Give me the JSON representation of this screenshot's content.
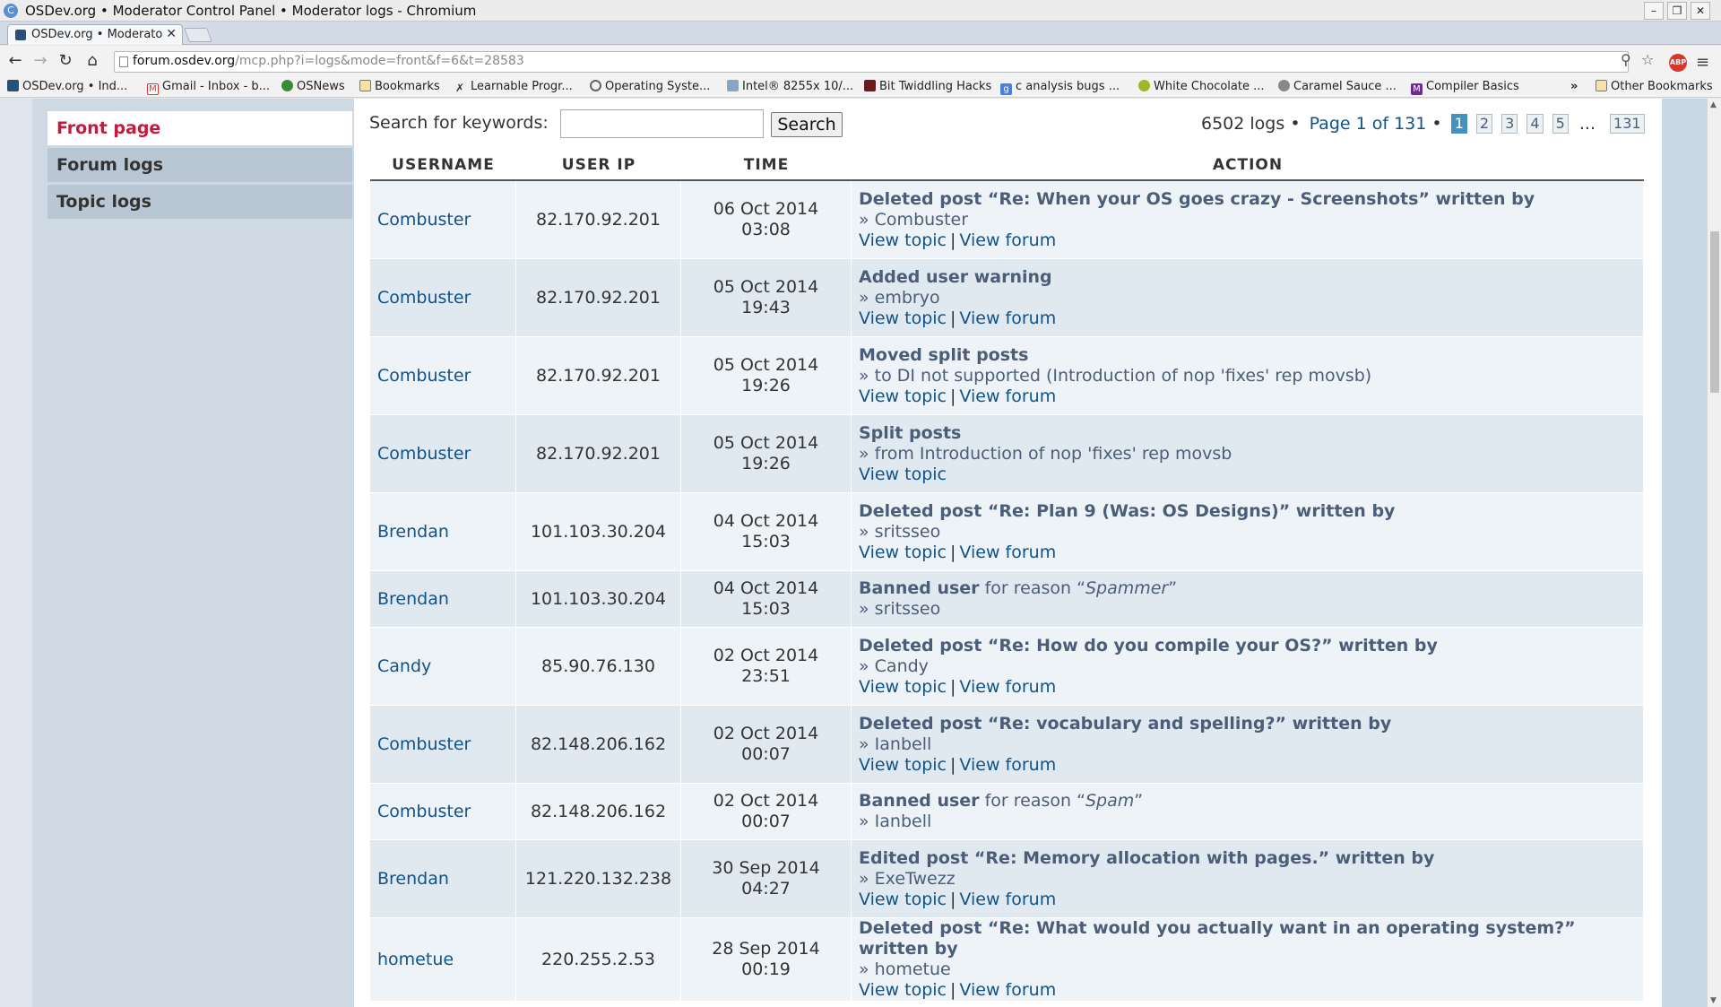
{
  "window": {
    "title": "OSDev.org • Moderator Control Panel • Moderator logs - Chromium"
  },
  "tabs": [
    {
      "title": "OSDev.org • Moderato"
    }
  ],
  "toolbar": {
    "url_host": "forum.osdev.org",
    "url_rest": "/mcp.php?i=logs&mode=front&f=6&t=28583"
  },
  "bookmarks": [
    "OSDev.org • Ind...",
    "Gmail - Inbox - b...",
    "OSNews",
    "Bookmarks",
    "Learnable Progr...",
    "Operating Syste...",
    "Intel® 8255x 10/...",
    "Bit Twiddling Hacks",
    "c analysis bugs ...",
    "White Chocolate ...",
    "Caramel Sauce ...",
    "Compiler Basics"
  ],
  "other_bookmarks": "Other Bookmarks",
  "overflow_chevron": "»",
  "sidebar": {
    "items": [
      "Front page",
      "Forum logs",
      "Topic logs"
    ]
  },
  "search": {
    "label": "Search for keywords:",
    "value": "",
    "button": "Search"
  },
  "pagination": {
    "count": "6502 logs",
    "sep": "•",
    "info": "Page 1 of 131",
    "pages": [
      "1",
      "2",
      "3",
      "4",
      "5"
    ],
    "ellipsis": "...",
    "last": "131"
  },
  "table": {
    "headers": [
      "USERNAME",
      "USER IP",
      "TIME",
      "ACTION"
    ],
    "rows": [
      {
        "user": "Combuster",
        "ip": "82.170.92.201",
        "date": "06 Oct 2014",
        "clock": "03:08",
        "action": "Deleted post “Re: When your OS goes crazy - Screenshots” written by",
        "reason": "",
        "reason_value": "",
        "reason_close": "",
        "detail": "» Combuster",
        "link1": "View topic",
        "link2": "View forum"
      },
      {
        "user": "Combuster",
        "ip": "82.170.92.201",
        "date": "05 Oct 2014",
        "clock": "19:43",
        "action": "Added user warning",
        "reason": "",
        "reason_value": "",
        "reason_close": "",
        "detail": "» embryo",
        "link1": "View topic",
        "link2": "View forum"
      },
      {
        "user": "Combuster",
        "ip": "82.170.92.201",
        "date": "05 Oct 2014",
        "clock": "19:26",
        "action": "Moved split posts",
        "reason": "",
        "reason_value": "",
        "reason_close": "",
        "detail": "» to DI not supported (Introduction of nop 'fixes' rep movsb)",
        "link1": "View topic",
        "link2": "View forum"
      },
      {
        "user": "Combuster",
        "ip": "82.170.92.201",
        "date": "05 Oct 2014",
        "clock": "19:26",
        "action": "Split posts",
        "reason": "",
        "reason_value": "",
        "reason_close": "",
        "detail": "» from Introduction of nop 'fixes' rep movsb",
        "link1": "View topic",
        "link2": ""
      },
      {
        "user": "Brendan",
        "ip": "101.103.30.204",
        "date": "04 Oct 2014",
        "clock": "15:03",
        "action": "Deleted post “Re: Plan 9 (Was: OS Designs)” written by",
        "reason": "",
        "reason_value": "",
        "reason_close": "",
        "detail": "» sritsseo",
        "link1": "View topic",
        "link2": "View forum"
      },
      {
        "user": "Brendan",
        "ip": "101.103.30.204",
        "date": "04 Oct 2014",
        "clock": "15:03",
        "action": "Banned user",
        "reason": " for reason “",
        "reason_value": "Spammer",
        "reason_close": "”",
        "detail": "» sritsseo",
        "link1": "",
        "link2": ""
      },
      {
        "user": "Candy",
        "ip": "85.90.76.130",
        "date": "02 Oct 2014",
        "clock": "23:51",
        "action": "Deleted post “Re: How do you compile your OS?” written by",
        "reason": "",
        "reason_value": "",
        "reason_close": "",
        "detail": "» Candy",
        "link1": "View topic",
        "link2": "View forum"
      },
      {
        "user": "Combuster",
        "ip": "82.148.206.162",
        "date": "02 Oct 2014",
        "clock": "00:07",
        "action": "Deleted post “Re: vocabulary and spelling?” written by",
        "reason": "",
        "reason_value": "",
        "reason_close": "",
        "detail": "» Ianbell",
        "link1": "View topic",
        "link2": "View forum"
      },
      {
        "user": "Combuster",
        "ip": "82.148.206.162",
        "date": "02 Oct 2014",
        "clock": "00:07",
        "action": "Banned user",
        "reason": " for reason “",
        "reason_value": "Spam",
        "reason_close": "”",
        "detail": "» Ianbell",
        "link1": "",
        "link2": ""
      },
      {
        "user": "Brendan",
        "ip": "121.220.132.238",
        "date": "30 Sep 2014",
        "clock": "04:27",
        "action": "Edited post “Re: Memory allocation with pages.” written by",
        "reason": "",
        "reason_value": "",
        "reason_close": "",
        "detail": "» ExeTwezz",
        "link1": "View topic",
        "link2": "View forum"
      },
      {
        "user": "hometue",
        "ip": "220.255.2.53",
        "date": "28 Sep 2014",
        "clock": "00:19",
        "action": "Deleted post “Re: What would you actually want in an operating system?” written by",
        "reason": "",
        "reason_value": "",
        "reason_close": "",
        "detail": "» hometue",
        "link1": "View topic",
        "link2": "View forum"
      }
    ]
  }
}
